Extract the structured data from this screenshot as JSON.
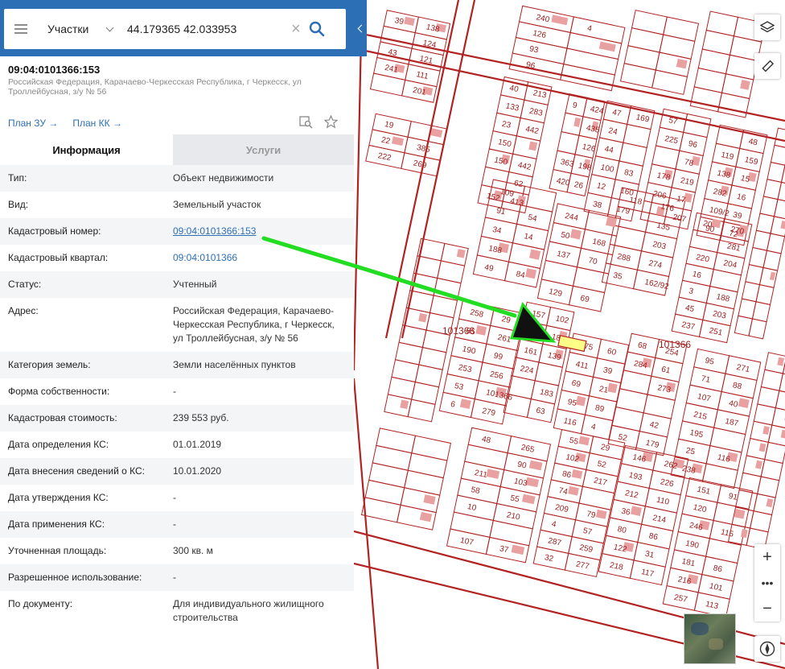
{
  "search": {
    "layer": "Участки",
    "value": "44.179365 42.033953"
  },
  "object": {
    "title": "09:04:0101366:153",
    "address": "Российская Федерация, Карачаево-Черкесская Республика, г Черкесск, ул Троллейбусная, з/у № 56",
    "plan_zu": "План ЗУ",
    "plan_kk": "План КК"
  },
  "tabs": [
    {
      "label": "Информация"
    },
    {
      "label": "Услуги"
    }
  ],
  "attributes": [
    {
      "key": "Тип:",
      "value": "Объект недвижимости"
    },
    {
      "key": "Вид:",
      "value": "Земельный участок"
    },
    {
      "key": "Кадастровый номер:",
      "value": "09:04:0101366:153"
    },
    {
      "key": "Кадастровый квартал:",
      "value": "09:04:0101366"
    },
    {
      "key": "Статус:",
      "value": "Учтенный"
    },
    {
      "key": "Адрес:",
      "value": "Российская Федерация, Карачаево-Черкесская Республика, г Черкесск, ул Троллейбусная, з/у № 56"
    },
    {
      "key": "Категория земель:",
      "value": "Земли населённых пунктов"
    },
    {
      "key": "Форма собственности:",
      "value": "-"
    },
    {
      "key": "Кадастровая стоимость:",
      "value": "239 553 руб."
    },
    {
      "key": "Дата определения КС:",
      "value": "01.01.2019"
    },
    {
      "key": "Дата внесения сведений о КС:",
      "value": "10.01.2020"
    },
    {
      "key": "Дата утверждения КС:",
      "value": "-"
    },
    {
      "key": "Дата применения КС:",
      "value": "-"
    },
    {
      "key": "Уточненная площадь:",
      "value": "300 кв. м"
    },
    {
      "key": "Разрешенное использование:",
      "value": "-"
    },
    {
      "key": "По документу:",
      "value": "Для индивидуального жилищного строительства"
    }
  ],
  "map": {
    "quarter_labels": [
      "101366",
      "101366"
    ],
    "parcel_labels": [
      "19",
      "22",
      "222",
      "385",
      "269",
      "40",
      "133",
      "23",
      "150",
      "150",
      "152",
      "213",
      "283",
      "442",
      "442",
      "62",
      "413",
      "9",
      "363",
      "420",
      "424",
      "435",
      "126",
      "198",
      "26",
      "47",
      "24",
      "44",
      "100",
      "12",
      "38",
      "169",
      "83",
      "160",
      "179",
      "57",
      "225",
      "178",
      "206",
      "96",
      "78",
      "219",
      "17",
      "207",
      "119",
      "138",
      "282",
      "109/2",
      "90",
      "48",
      "159",
      "15",
      "16",
      "39",
      "72",
      "109",
      "91",
      "34",
      "188",
      "49",
      "54",
      "14",
      "84",
      "244",
      "50",
      "137",
      "129",
      "168",
      "70",
      "69",
      "118",
      "288",
      "35",
      "176",
      "135",
      "203",
      "274",
      "162/92",
      "20",
      "220",
      "16",
      "3",
      "45",
      "237",
      "270",
      "281",
      "204",
      "188",
      "203",
      "251",
      "258",
      "85",
      "190",
      "253",
      "53",
      "6",
      "29",
      "261",
      "99",
      "256",
      "101366",
      "279",
      "157",
      "76",
      "161",
      "224",
      "102",
      "185",
      "139",
      "183",
      "63",
      "175",
      "411",
      "69",
      "95",
      "116",
      "60",
      "39",
      "21",
      "89",
      "4",
      "68",
      "284",
      "52",
      "254",
      "61",
      "273",
      "42",
      "179",
      "95",
      "71",
      "107",
      "215",
      "195",
      "25",
      "238",
      "271",
      "88",
      "40",
      "187",
      "116",
      "48",
      "211",
      "58",
      "10",
      "107",
      "265",
      "90",
      "103",
      "55",
      "210",
      "37",
      "55",
      "102",
      "86",
      "74",
      "209",
      "4",
      "287",
      "32",
      "29",
      "52",
      "217",
      "79",
      "57",
      "259",
      "277",
      "146",
      "193",
      "212",
      "36",
      "80",
      "122",
      "218",
      "262",
      "226",
      "110",
      "214",
      "86",
      "31",
      "117",
      "151",
      "120",
      "246",
      "190",
      "181",
      "216",
      "257",
      "91",
      "115",
      "86",
      "101",
      "113",
      "39",
      "43",
      "241",
      "138",
      "124",
      "121",
      "111",
      "201",
      "240",
      "126",
      "93",
      "96",
      "4"
    ]
  }
}
